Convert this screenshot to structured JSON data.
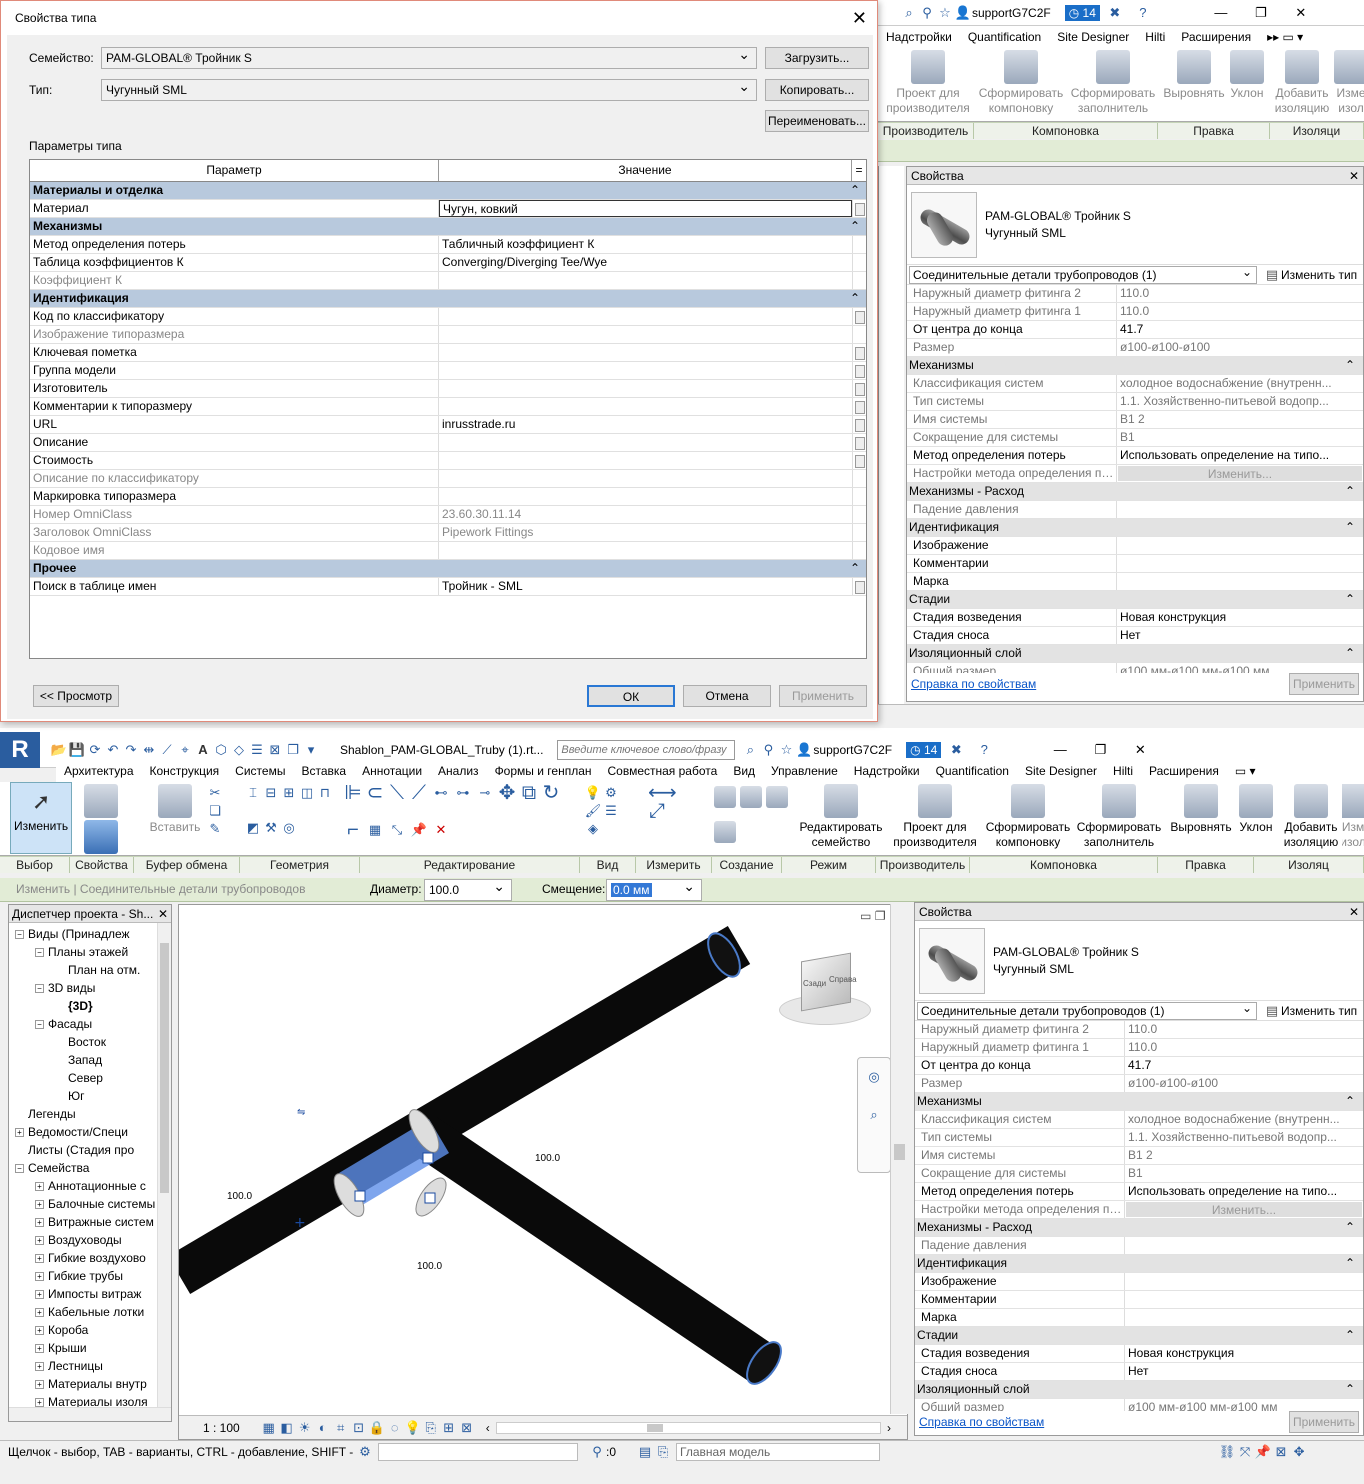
{
  "top_app": {
    "user": "supportG7C2F",
    "badge_count": "14",
    "menu": [
      "Надстройки",
      "Quantification",
      "Site Designer",
      "Hilti",
      "Расширения"
    ],
    "ribbon": [
      {
        "label": "Проект для производителя",
        "disabled": true
      },
      {
        "label": "Сформировать компоновку",
        "disabled": true
      },
      {
        "label": "Сформировать заполнитель",
        "disabled": true
      },
      {
        "label": "Выровнять",
        "disabled": true
      },
      {
        "label": "Уклон",
        "disabled": true
      },
      {
        "label": "Добавить изоляцию",
        "disabled": true
      },
      {
        "label": "Изме изол",
        "disabled": true
      }
    ],
    "panels": [
      "Производитель",
      "Компоновка",
      "Правка",
      "Изоляци"
    ]
  },
  "properties": {
    "title": "Свойства",
    "family": "PAM-GLOBAL® Тройник S",
    "type": "Чугунный SML",
    "selector": "Соединительные детали трубопроводов (1)",
    "edit_type": "Изменить тип",
    "rows": [
      {
        "k": "Наружный диаметр фитинга 2",
        "v": "110.0",
        "g": true
      },
      {
        "k": "Наружный диаметр фитинга 1",
        "v": "110.0",
        "g": true
      },
      {
        "k": "От центра до конца",
        "v": "41.7"
      },
      {
        "k": "Размер",
        "v": "ø100-ø100-ø100",
        "g": true
      },
      {
        "sec": "Механизмы"
      },
      {
        "k": "Классификация систем",
        "v": "холодное водоснабжение (внутренн...",
        "g": true
      },
      {
        "k": "Тип системы",
        "v": "1.1. Хозяйственно-питьевой водопр...",
        "g": true
      },
      {
        "k": "Имя системы",
        "v": "В1 2",
        "g": true
      },
      {
        "k": "Сокращение для системы",
        "v": "В1",
        "g": true
      },
      {
        "k": "Метод определения потерь",
        "v": "Использовать определение на типо..."
      },
      {
        "k": "Настройки метода определения по...",
        "btn": "Изменить...",
        "g": true
      },
      {
        "sec": "Механизмы - Расход"
      },
      {
        "k": "Падение давления",
        "v": "",
        "g": true
      },
      {
        "sec": "Идентификация"
      },
      {
        "k": "Изображение",
        "v": ""
      },
      {
        "k": "Комментарии",
        "v": ""
      },
      {
        "k": "Марка",
        "v": ""
      },
      {
        "sec": "Стадии"
      },
      {
        "k": "Стадия возведения",
        "v": "Новая конструкция"
      },
      {
        "k": "Стадия сноса",
        "v": "Нет"
      },
      {
        "sec": "Изоляционный слой"
      },
      {
        "k": "Общий размер",
        "v": "ø100 мм-ø100 мм-ø100 мм",
        "g": true
      }
    ],
    "help": "Справка по свойствам",
    "apply": "Применить"
  },
  "dialog": {
    "title": "Свойства типа",
    "family_label": "Семейство:",
    "family_value": "PAM-GLOBAL® Тройник S",
    "type_label": "Тип:",
    "type_value": "Чугунный SML",
    "load": "Загрузить...",
    "copy": "Копировать...",
    "rename": "Переименовать...",
    "params_label": "Параметры типа",
    "col_param": "Параметр",
    "col_value": "Значение",
    "col_eq": "=",
    "rows": [
      {
        "sec": "Материалы и отделка"
      },
      {
        "k": "Материал",
        "v": "Чугун, ковкий",
        "edit": true,
        "b": true
      },
      {
        "sec": "Механизмы"
      },
      {
        "k": "Метод определения потерь",
        "v": "Табличный коэффициент К"
      },
      {
        "k": "Таблица коэффициентов К",
        "v": "Converging/Diverging Tee/Wye"
      },
      {
        "k": "Коэффициент К",
        "v": "",
        "g": true
      },
      {
        "sec": "Идентификация"
      },
      {
        "k": "Код по классификатору",
        "v": "",
        "b": true
      },
      {
        "k": "Изображение типоразмера",
        "v": "",
        "g": true
      },
      {
        "k": "Ключевая пометка",
        "v": "",
        "b": true
      },
      {
        "k": "Группа модели",
        "v": "",
        "b": true
      },
      {
        "k": "Изготовитель",
        "v": "",
        "b": true
      },
      {
        "k": "Комментарии к типоразмеру",
        "v": "",
        "b": true
      },
      {
        "k": "URL",
        "v": "inrusstrade.ru",
        "b": true
      },
      {
        "k": "Описание",
        "v": "",
        "b": true
      },
      {
        "k": "Стоимость",
        "v": "",
        "b": true
      },
      {
        "k": "Описание по классификатору",
        "v": "",
        "g": true
      },
      {
        "k": "Маркировка типоразмера",
        "v": ""
      },
      {
        "k": "Номер OmniClass",
        "v": "23.60.30.11.14",
        "g": true
      },
      {
        "k": "Заголовок OmniClass",
        "v": "Pipework Fittings",
        "g": true
      },
      {
        "k": "Кодовое имя",
        "v": "",
        "g": true
      },
      {
        "sec": "Прочее"
      },
      {
        "k": "Поиск в таблице имен",
        "v": "Тройник - SML",
        "b": true
      }
    ],
    "preview": "<< Просмотр",
    "ok": "ОК",
    "cancel": "Отмена",
    "apply": "Применить"
  },
  "bottom_app": {
    "file_title": "Shablon_PAM-GLOBAL_Truby (1).rt...",
    "search_placeholder": "Введите ключевое слово/фразу",
    "user": "supportG7C2F",
    "badge_count": "14",
    "menu": [
      "Архитектура",
      "Конструкция",
      "Системы",
      "Вставка",
      "Аннотации",
      "Анализ",
      "Формы и генплан",
      "Совместная работа",
      "Вид",
      "Управление",
      "Надстройки",
      "Quantification",
      "Site Designer",
      "Hilti",
      "Расширения"
    ],
    "ribbon": {
      "modify": "Изменить",
      "paste": "Вставить",
      "edit_family": "Редактировать семейство",
      "fab_project": "Проект для производителя",
      "form_layout": "Сформировать компоновку",
      "form_fill": "Сформировать заполнитель",
      "align": "Выровнять",
      "slope": "Уклон",
      "add_insul": "Добавить изоляцию",
      "edit_insul": "Изм изол"
    },
    "panels": [
      "Выбор",
      "Свойства",
      "Буфер обмена",
      "Геометрия",
      "Редактирование",
      "Вид",
      "Измерить",
      "Создание",
      "Режим",
      "Производитель",
      "Компоновка",
      "Правка",
      "Изоляц"
    ],
    "context": "Изменить | Соединительные детали трубопроводов",
    "diameter_label": "Диаметр:",
    "diameter_value": "100.0",
    "offset_label": "Смещение:",
    "offset_value": "0.0 мм",
    "browser_title": "Диспетчер проекта - Sh...",
    "tree": [
      {
        "t": "Виды (Принадлеж",
        "l": 0,
        "pm": "-"
      },
      {
        "t": "Планы этажей",
        "l": 1,
        "pm": "-"
      },
      {
        "t": "План на  отм.",
        "l": 2
      },
      {
        "t": "3D виды",
        "l": 1,
        "pm": "-"
      },
      {
        "t": "{3D}",
        "l": 2,
        "bold": true
      },
      {
        "t": "Фасады",
        "l": 1,
        "pm": "-"
      },
      {
        "t": "Восток",
        "l": 2
      },
      {
        "t": "Запад",
        "l": 2
      },
      {
        "t": "Север",
        "l": 2
      },
      {
        "t": "Юг",
        "l": 2
      },
      {
        "t": "Легенды",
        "l": 0
      },
      {
        "t": "Ведомости/Специ",
        "l": 0,
        "pm": "+"
      },
      {
        "t": "Листы (Стадия про",
        "l": 0
      },
      {
        "t": "Семейства",
        "l": 0,
        "pm": "-"
      },
      {
        "t": "Аннотационные с",
        "l": 1,
        "pm": "+"
      },
      {
        "t": "Балочные системы",
        "l": 1,
        "pm": "+"
      },
      {
        "t": "Витражные систем",
        "l": 1,
        "pm": "+"
      },
      {
        "t": "Воздуховоды",
        "l": 1,
        "pm": "+"
      },
      {
        "t": "Гибкие воздухово",
        "l": 1,
        "pm": "+"
      },
      {
        "t": "Гибкие трубы",
        "l": 1,
        "pm": "+"
      },
      {
        "t": "Импосты витраж",
        "l": 1,
        "pm": "+"
      },
      {
        "t": "Кабельные лотки",
        "l": 1,
        "pm": "+"
      },
      {
        "t": "Короба",
        "l": 1,
        "pm": "+"
      },
      {
        "t": "Крыши",
        "l": 1,
        "pm": "+"
      },
      {
        "t": "Лестницы",
        "l": 1,
        "pm": "+"
      },
      {
        "t": "Материалы внутр",
        "l": 1,
        "pm": "+"
      },
      {
        "t": "Материалы изоля",
        "l": 1,
        "pm": "+"
      },
      {
        "t": "Материалы изоля",
        "l": 1,
        "pm": "+"
      }
    ],
    "dim_labels": [
      "100.0",
      "100.0",
      "100.0"
    ],
    "viewcube": [
      "Сзади",
      "Справа"
    ],
    "scale": "1 : 100",
    "status": "Щелчок - выбор, TAB - варианты, CTRL - добавление, SHIFT - с",
    "sel_count": ":0",
    "model": "Главная модель"
  }
}
